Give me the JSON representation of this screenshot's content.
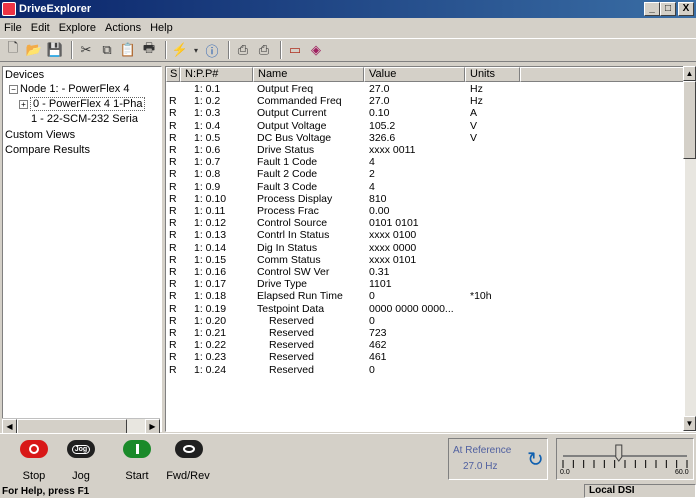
{
  "window": {
    "title": "DriveExplorer",
    "min": "_",
    "max": "□",
    "close": "X"
  },
  "menu": [
    "File",
    "Edit",
    "Explore",
    "Actions",
    "Help"
  ],
  "tree": {
    "items": [
      {
        "label": "Devices"
      },
      {
        "label": "Node 1: - PowerFlex 4"
      },
      {
        "label": "0 - PowerFlex 4 1-Pha"
      },
      {
        "label": "1 - 22-SCM-232 Seria"
      },
      {
        "label": "Custom Views"
      },
      {
        "label": "Compare Results"
      }
    ]
  },
  "list": {
    "headers": [
      "S",
      "N:P.P#",
      "Name",
      "Value",
      "Units"
    ],
    "rows": [
      {
        "s": "",
        "num": "1: 0.1",
        "name": "Output Freq",
        "value": "27.0",
        "units": "Hz"
      },
      {
        "s": "R",
        "num": "1: 0.2",
        "name": "Commanded Freq",
        "value": "27.0",
        "units": "Hz"
      },
      {
        "s": "R",
        "num": "1: 0.3",
        "name": "Output Current",
        "value": "0.10",
        "units": "A"
      },
      {
        "s": "R",
        "num": "1: 0.4",
        "name": "Output Voltage",
        "value": "105.2",
        "units": "V"
      },
      {
        "s": "R",
        "num": "1: 0.5",
        "name": "DC Bus Voltage",
        "value": "326.6",
        "units": "V"
      },
      {
        "s": "R",
        "num": "1: 0.6",
        "name": "Drive Status",
        "value": "xxxx 0011",
        "units": ""
      },
      {
        "s": "R",
        "num": "1: 0.7",
        "name": "Fault 1 Code",
        "value": "4",
        "units": ""
      },
      {
        "s": "R",
        "num": "1: 0.8",
        "name": "Fault 2 Code",
        "value": "2",
        "units": ""
      },
      {
        "s": "R",
        "num": "1: 0.9",
        "name": "Fault 3 Code",
        "value": "4",
        "units": ""
      },
      {
        "s": "R",
        "num": "1: 0.10",
        "name": "Process Display",
        "value": "810",
        "units": ""
      },
      {
        "s": "R",
        "num": "1: 0.11",
        "name": "Process Frac",
        "value": "0.00",
        "units": ""
      },
      {
        "s": "R",
        "num": "1: 0.12",
        "name": "Control Source",
        "value": "0101 0101",
        "units": ""
      },
      {
        "s": "R",
        "num": "1: 0.13",
        "name": "Contrl In Status",
        "value": "xxxx 0100",
        "units": ""
      },
      {
        "s": "R",
        "num": "1: 0.14",
        "name": "Dig In Status",
        "value": "xxxx 0000",
        "units": ""
      },
      {
        "s": "R",
        "num": "1: 0.15",
        "name": "Comm Status",
        "value": "xxxx 0101",
        "units": ""
      },
      {
        "s": "R",
        "num": "1: 0.16",
        "name": "Control SW Ver",
        "value": "0.31",
        "units": ""
      },
      {
        "s": "R",
        "num": "1: 0.17",
        "name": "Drive Type",
        "value": "1101",
        "units": ""
      },
      {
        "s": "R",
        "num": "1: 0.18",
        "name": "Elapsed Run Time",
        "value": "0",
        "units": "*10h"
      },
      {
        "s": "R",
        "num": "1: 0.19",
        "name": "Testpoint Data",
        "value": "0000 0000 0000...",
        "units": ""
      },
      {
        "s": "R",
        "num": "1: 0.20",
        "name": "  Reserved",
        "value": "0",
        "units": ""
      },
      {
        "s": "R",
        "num": "1: 0.21",
        "name": "  Reserved",
        "value": "723",
        "units": ""
      },
      {
        "s": "R",
        "num": "1: 0.22",
        "name": "  Reserved",
        "value": "462",
        "units": ""
      },
      {
        "s": "R",
        "num": "1: 0.23",
        "name": "  Reserved",
        "value": "461",
        "units": ""
      },
      {
        "s": "R",
        "num": "1: 0.24",
        "name": "  Reserved",
        "value": "0",
        "units": ""
      }
    ]
  },
  "controls": {
    "stop": "Stop",
    "jog": "Jog",
    "jog_icon": "Jog",
    "start": "Start",
    "fwdrev": "Fwd/Rev",
    "colors": {
      "stop": "#d81818",
      "jog": "#202020",
      "start": "#1a8a2a",
      "fwdrev": "#202020"
    }
  },
  "reference": {
    "label": "At Reference",
    "value": "27.0 Hz"
  },
  "slider": {
    "min": "0.0",
    "max": "60.0",
    "value": 27.0
  },
  "status": {
    "help": "For Help, press F1",
    "connection": "Local DSI"
  }
}
